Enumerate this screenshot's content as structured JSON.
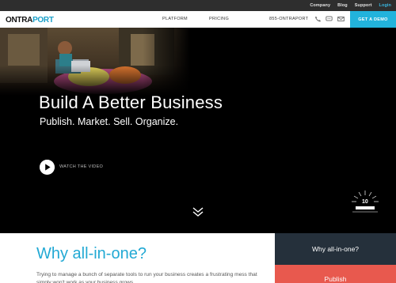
{
  "topbar": {
    "links": [
      "Company",
      "Blog",
      "Support",
      "Login"
    ]
  },
  "navbar": {
    "logo_main": "ONTRA",
    "logo_accent": "PORT",
    "items": [
      "PLATFORM",
      "PRICING"
    ],
    "phone": "855-ONTRAPORT",
    "demo_label": "GET A DEMO"
  },
  "hero": {
    "title": "Build A Better Business",
    "subtitle": "Publish. Market. Sell. Organize.",
    "watch_label": "WATCH THE VIDEO",
    "badge_number": "10"
  },
  "content": {
    "heading": "Why all-in-one?",
    "body": "Trying to manage a bunch of separate tools to run your business creates a frustrating mess that simply won't work as your business grows."
  },
  "side": {
    "card_label": "Why all-in-one?",
    "publish_label": "Publish"
  },
  "colors": {
    "accent": "#22b3dc",
    "dark": "#25303b",
    "publish": "#e8594e"
  }
}
